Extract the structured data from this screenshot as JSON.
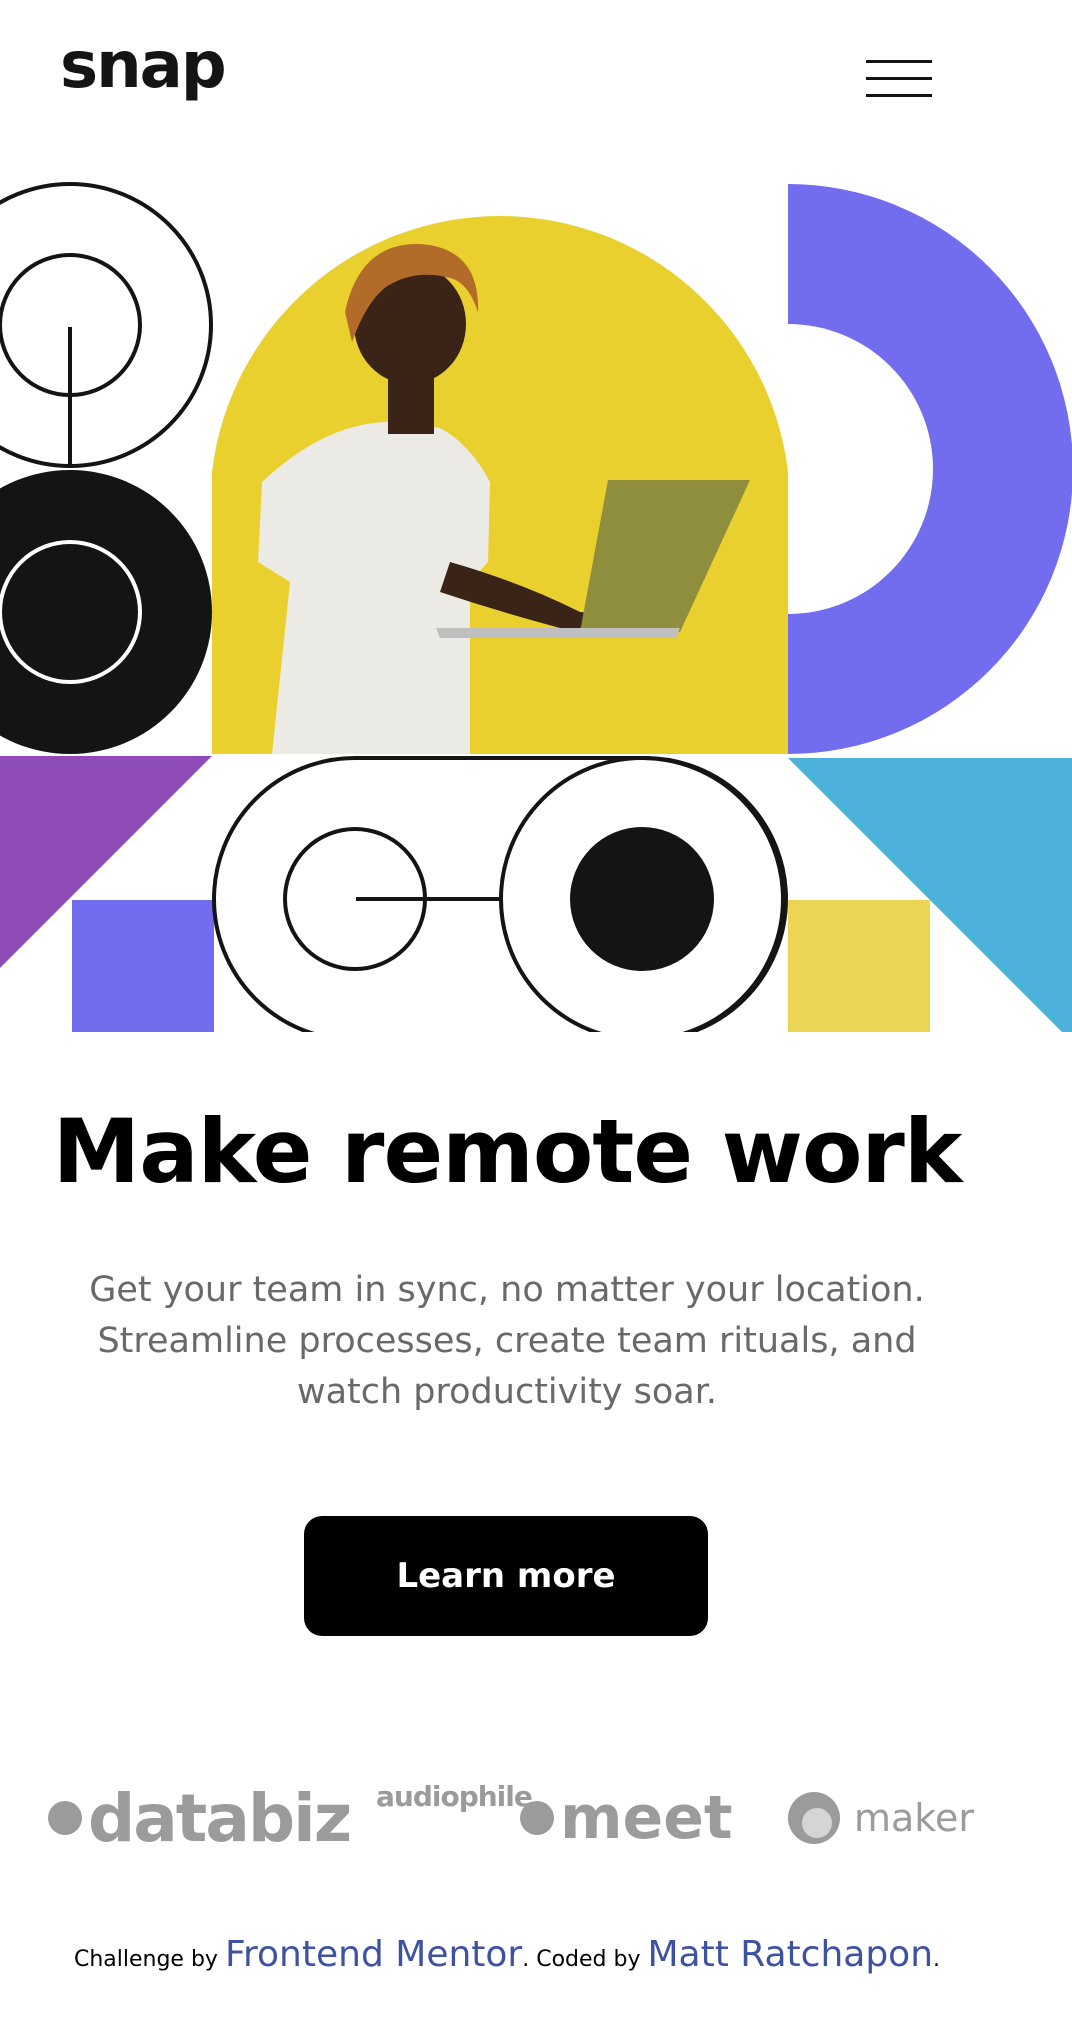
{
  "header": {
    "logo": "snap",
    "menu_icon": "hamburger-menu-icon"
  },
  "hero": {
    "image_alt": "person holding laptop",
    "colors": {
      "yellow": "#E9D02E",
      "purple": "#726CEE",
      "violet": "#8F4BB8",
      "blue": "#4BB1DA",
      "light_yellow": "#ECD454",
      "black": "#141414"
    }
  },
  "main": {
    "headline": "Make remote work",
    "subtext": "Get your team in sync, no matter your location. Streamline processes, create team rituals, and watch productivity soar.",
    "cta_label": "Learn more"
  },
  "clients": [
    "databiz",
    "audiophile",
    "meet",
    "maker"
  ],
  "footer": {
    "challenge_prefix": "Challenge by",
    "challenge_link": "Frontend Mentor",
    "coded_prefix": ". Coded by",
    "coded_link": "Matt Ratchapon",
    "suffix": "."
  }
}
